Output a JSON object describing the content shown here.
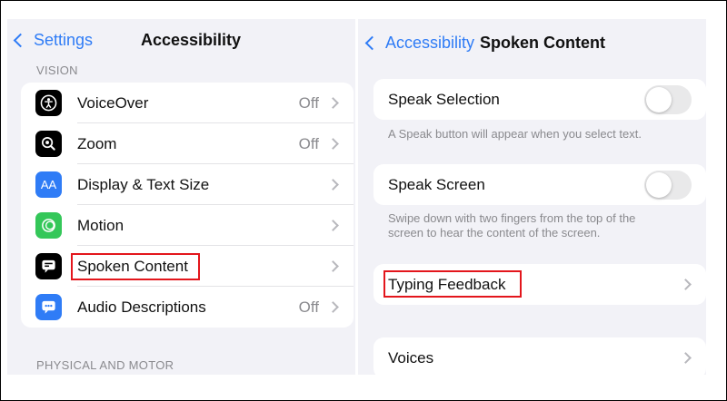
{
  "left": {
    "back_label": "Settings",
    "title": "Accessibility",
    "section_vision": "VISION",
    "items": [
      {
        "label": "VoiceOver",
        "value": "Off",
        "icon": "voiceover-icon",
        "icon_color": "#000000"
      },
      {
        "label": "Zoom",
        "value": "Off",
        "icon": "zoom-icon",
        "icon_color": "#000000"
      },
      {
        "label": "Display & Text Size",
        "value": "",
        "icon": "display-text-size-icon",
        "icon_color": "#2f7cf6",
        "icon_glyph": "AA"
      },
      {
        "label": "Motion",
        "value": "",
        "icon": "motion-icon",
        "icon_color": "#34c759"
      },
      {
        "label": "Spoken Content",
        "value": "",
        "icon": "spoken-content-icon",
        "icon_color": "#000000"
      },
      {
        "label": "Audio Descriptions",
        "value": "Off",
        "icon": "audio-descriptions-icon",
        "icon_color": "#2f7cf6"
      }
    ],
    "section_physical": "PHYSICAL AND MOTOR"
  },
  "right": {
    "back_label": "Accessibility",
    "title": "Spoken Content",
    "speak_selection": {
      "label": "Speak Selection",
      "enabled": false,
      "footnote": "A Speak button will appear when you select text."
    },
    "speak_screen": {
      "label": "Speak Screen",
      "enabled": false,
      "footnote_line1": "Swipe down with two fingers from the top of the",
      "footnote_line2": "screen to hear the content of the screen."
    },
    "typing_feedback": {
      "label": "Typing Feedback"
    },
    "voices": {
      "label": "Voices"
    }
  },
  "colors": {
    "accent": "#2f7cf6",
    "highlight": "#e3161c",
    "background": "#f2f2f7"
  }
}
